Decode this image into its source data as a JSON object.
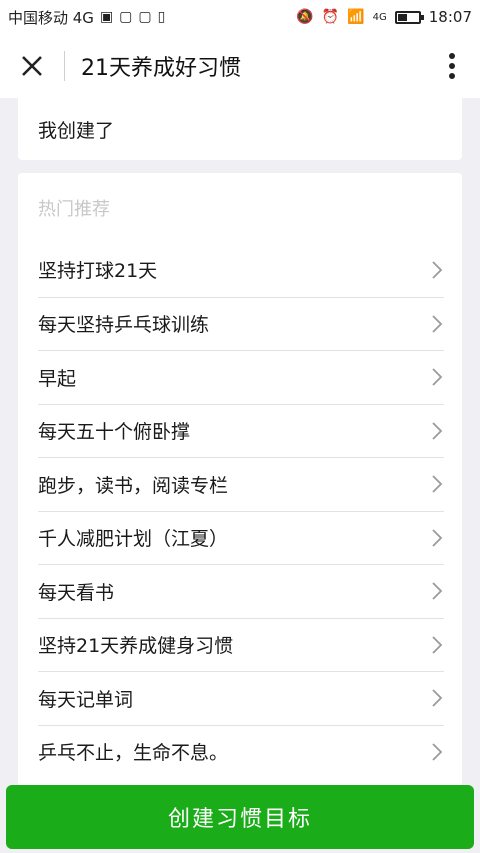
{
  "statusbar": {
    "carrier": "中国移动 4G",
    "net_badge": "4G",
    "time": "18:07",
    "battery_level": 0.45
  },
  "header": {
    "title": "21天养成好习惯",
    "close_icon": "close-icon",
    "more_icon": "more-vertical-icon"
  },
  "mine": {
    "label": "我创建了"
  },
  "popular": {
    "heading": "热门推荐",
    "items": [
      {
        "label": "坚持打球21天"
      },
      {
        "label": "每天坚持乒乓球训练"
      },
      {
        "label": "早起"
      },
      {
        "label": "每天五十个俯卧撑"
      },
      {
        "label": "跑步，读书，阅读专栏"
      },
      {
        "label": "千人减肥计划（江夏）"
      },
      {
        "label": "每天看书"
      },
      {
        "label": "坚持21天养成健身习惯"
      },
      {
        "label": "每天记单词"
      },
      {
        "label": "乒乓不止，生命不息。"
      }
    ]
  },
  "footer": {
    "create_button": "创建习惯目标"
  },
  "colors": {
    "accent": "#1aad19",
    "background": "#efeff4"
  }
}
